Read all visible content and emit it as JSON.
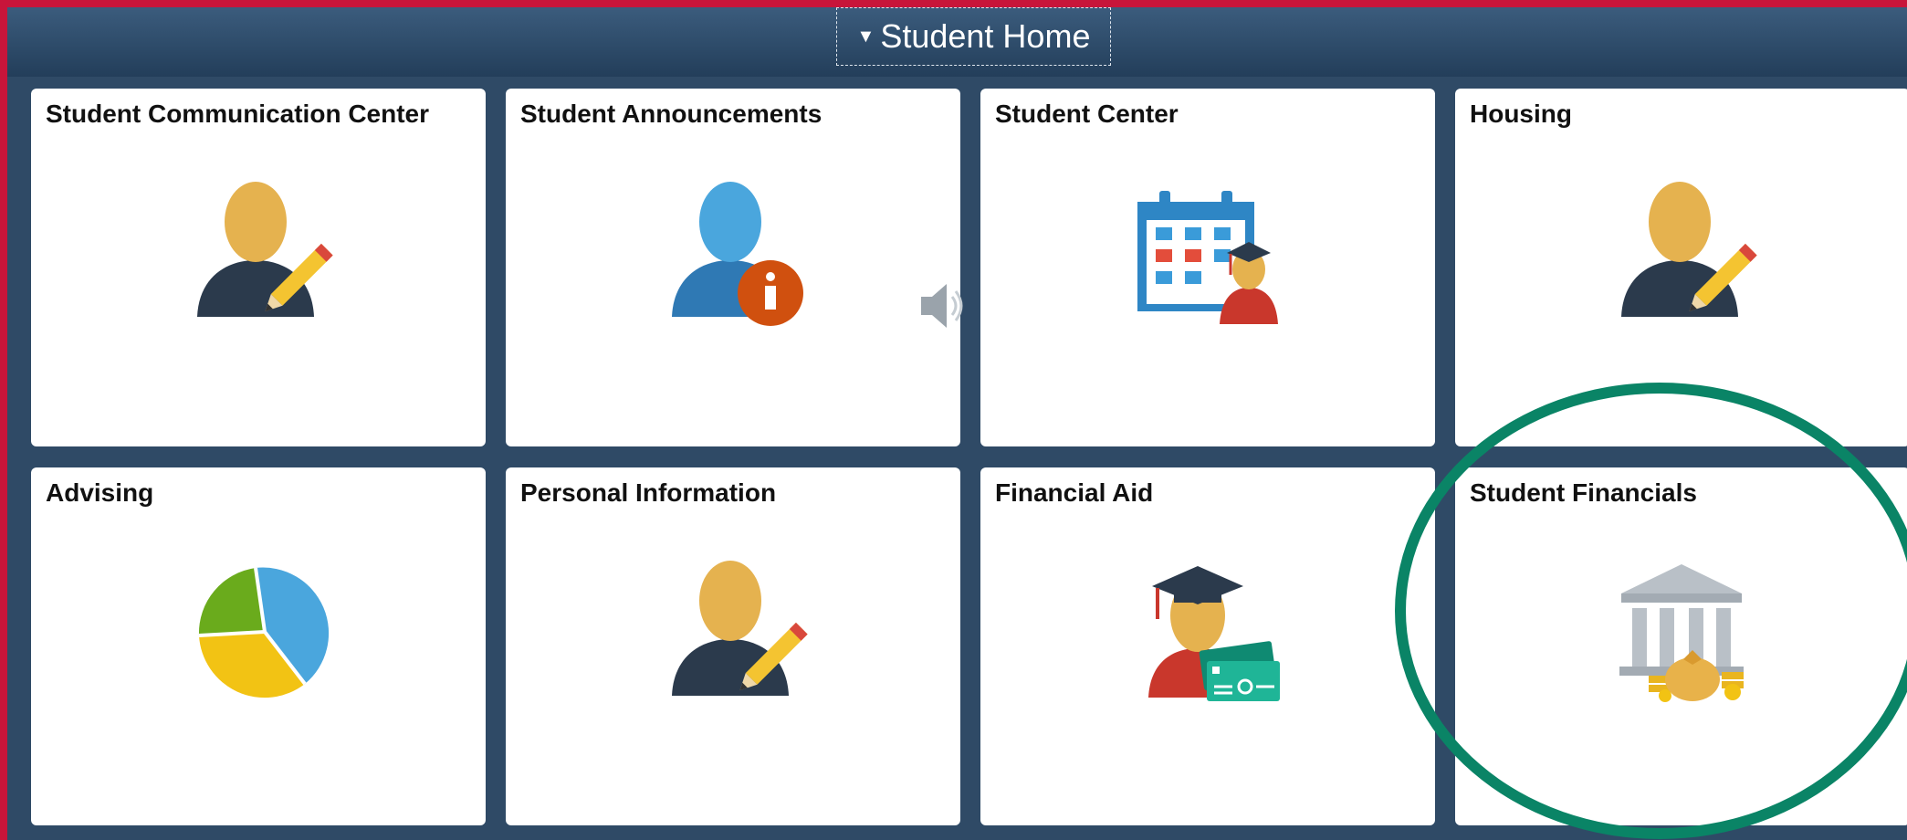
{
  "header": {
    "title": "Student Home",
    "dropdown_icon": "caret-down-icon"
  },
  "tiles": [
    {
      "title": "Student Communication Center",
      "icon": "person-pencil-icon"
    },
    {
      "title": "Student Announcements",
      "icon": "person-info-icon"
    },
    {
      "title": "Student Center",
      "icon": "calendar-student-icon"
    },
    {
      "title": "Housing",
      "icon": "person-pencil-icon"
    },
    {
      "title": "Advising",
      "icon": "pie-chart-icon"
    },
    {
      "title": "Personal Information",
      "icon": "person-pencil-icon"
    },
    {
      "title": "Financial Aid",
      "icon": "graduate-money-icon"
    },
    {
      "title": "Student Financials",
      "icon": "bank-money-bag-icon"
    }
  ],
  "overlay": {
    "speaker_icon": "speaker-icon",
    "highlight_color": "#0a8466"
  }
}
